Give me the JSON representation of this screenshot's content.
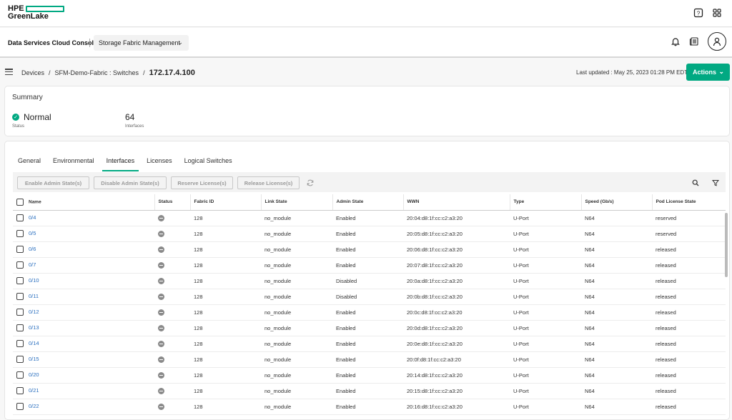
{
  "brand": {
    "line1": "HPE",
    "line2": "GreenLake"
  },
  "console": {
    "title": "Data Services Cloud Console",
    "service": "Storage Fabric Management"
  },
  "breadcrumb": {
    "devices": "Devices",
    "fabric": "SFM-Demo-Fabric : Switches",
    "current": "172.17.4.100"
  },
  "last_updated": "Last updated :  May 25, 2023 01:28 PM EDT",
  "actions_label": "Actions",
  "summary": {
    "title": "Summary",
    "status_value": "Normal",
    "status_caption": "Status",
    "interfaces_value": "64",
    "interfaces_caption": "Interfaces"
  },
  "tabs": [
    "General",
    "Environmental",
    "Interfaces",
    "Licenses",
    "Logical Switches"
  ],
  "active_tab": "Interfaces",
  "toolbar": {
    "enable": "Enable Admin State(s)",
    "disable": "Disable Admin State(s)",
    "reserve": "Reserve License(s)",
    "release": "Release License(s)"
  },
  "columns": [
    "Name",
    "Status",
    "Fabric ID",
    "Link State",
    "Admin State",
    "WWN",
    "Type",
    "Speed (Gb/s)",
    "Pod License State"
  ],
  "rows": [
    {
      "name": "0/4",
      "fabric_id": "128",
      "link": "no_module",
      "admin": "Enabled",
      "wwn": "20:04:d8:1f:cc:c2:a3:20",
      "type": "U-Port",
      "speed": "N64",
      "license": "reserved"
    },
    {
      "name": "0/5",
      "fabric_id": "128",
      "link": "no_module",
      "admin": "Enabled",
      "wwn": "20:05:d8:1f:cc:c2:a3:20",
      "type": "U-Port",
      "speed": "N64",
      "license": "reserved"
    },
    {
      "name": "0/6",
      "fabric_id": "128",
      "link": "no_module",
      "admin": "Enabled",
      "wwn": "20:06:d8:1f:cc:c2:a3:20",
      "type": "U-Port",
      "speed": "N64",
      "license": "released"
    },
    {
      "name": "0/7",
      "fabric_id": "128",
      "link": "no_module",
      "admin": "Enabled",
      "wwn": "20:07:d8:1f:cc:c2:a3:20",
      "type": "U-Port",
      "speed": "N64",
      "license": "released"
    },
    {
      "name": "0/10",
      "fabric_id": "128",
      "link": "no_module",
      "admin": "Disabled",
      "wwn": "20:0a:d8:1f:cc:c2:a3:20",
      "type": "U-Port",
      "speed": "N64",
      "license": "released"
    },
    {
      "name": "0/11",
      "fabric_id": "128",
      "link": "no_module",
      "admin": "Disabled",
      "wwn": "20:0b:d8:1f:cc:c2:a3:20",
      "type": "U-Port",
      "speed": "N64",
      "license": "released"
    },
    {
      "name": "0/12",
      "fabric_id": "128",
      "link": "no_module",
      "admin": "Enabled",
      "wwn": "20:0c:d8:1f:cc:c2:a3:20",
      "type": "U-Port",
      "speed": "N64",
      "license": "released"
    },
    {
      "name": "0/13",
      "fabric_id": "128",
      "link": "no_module",
      "admin": "Enabled",
      "wwn": "20:0d:d8:1f:cc:c2:a3:20",
      "type": "U-Port",
      "speed": "N64",
      "license": "released"
    },
    {
      "name": "0/14",
      "fabric_id": "128",
      "link": "no_module",
      "admin": "Enabled",
      "wwn": "20:0e:d8:1f:cc:c2:a3:20",
      "type": "U-Port",
      "speed": "N64",
      "license": "released"
    },
    {
      "name": "0/15",
      "fabric_id": "128",
      "link": "no_module",
      "admin": "Enabled",
      "wwn": "20:0f:d8:1f:cc:c2:a3:20",
      "type": "U-Port",
      "speed": "N64",
      "license": "released"
    },
    {
      "name": "0/20",
      "fabric_id": "128",
      "link": "no_module",
      "admin": "Enabled",
      "wwn": "20:14:d8:1f:cc:c2:a3:20",
      "type": "U-Port",
      "speed": "N64",
      "license": "released"
    },
    {
      "name": "0/21",
      "fabric_id": "128",
      "link": "no_module",
      "admin": "Enabled",
      "wwn": "20:15:d8:1f:cc:c2:a3:20",
      "type": "U-Port",
      "speed": "N64",
      "license": "released"
    },
    {
      "name": "0/22",
      "fabric_id": "128",
      "link": "no_module",
      "admin": "Enabled",
      "wwn": "20:16:d8:1f:cc:c2:a3:20",
      "type": "U-Port",
      "speed": "N64",
      "license": "released"
    }
  ],
  "colors": {
    "accent": "#01a982",
    "link": "#2a6fbf"
  },
  "icons": [
    "help-icon",
    "apps-grid-icon",
    "bell-icon",
    "news-icon",
    "user-icon",
    "menu-icon",
    "refresh-icon",
    "search-icon",
    "filter-icon",
    "check-circle-icon",
    "status-minus-icon"
  ]
}
